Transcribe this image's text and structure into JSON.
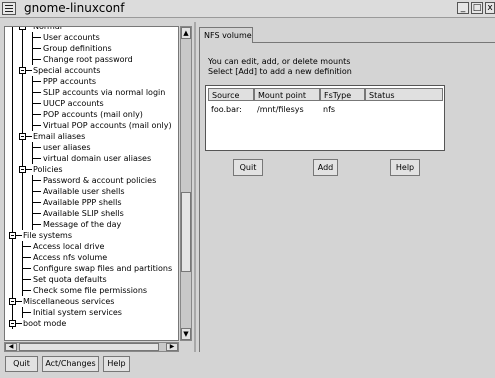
{
  "window": {
    "title": "gnome-linuxconf",
    "buttons": [
      "_",
      "□",
      "x"
    ]
  },
  "tree": {
    "items": [
      {
        "label": "Normal",
        "level": 1,
        "expanded": true
      },
      {
        "label": "User accounts",
        "level": 2
      },
      {
        "label": "Group definitions",
        "level": 2
      },
      {
        "label": "Change root password",
        "level": 2
      },
      {
        "label": "Special accounts",
        "level": 1,
        "expanded": true
      },
      {
        "label": "PPP accounts",
        "level": 2
      },
      {
        "label": "SLIP accounts via normal login",
        "level": 2
      },
      {
        "label": "UUCP accounts",
        "level": 2
      },
      {
        "label": "POP accounts (mail only)",
        "level": 2
      },
      {
        "label": "Virtual POP accounts (mail only)",
        "level": 2
      },
      {
        "label": "Email aliases",
        "level": 1,
        "expanded": true
      },
      {
        "label": "user aliases",
        "level": 2
      },
      {
        "label": "virtual domain user aliases",
        "level": 2
      },
      {
        "label": "Policies",
        "level": 1,
        "expanded": true
      },
      {
        "label": "Password & account policies",
        "level": 2
      },
      {
        "label": "Available user shells",
        "level": 2
      },
      {
        "label": "Available PPP shells",
        "level": 2
      },
      {
        "label": "Available SLIP shells",
        "level": 2
      },
      {
        "label": "Message of the day",
        "level": 2
      },
      {
        "label": "File systems",
        "level": 0,
        "expanded": true
      },
      {
        "label": "Access local drive",
        "level": 1
      },
      {
        "label": "Access nfs volume",
        "level": 1
      },
      {
        "label": "Configure swap files and partitions",
        "level": 1
      },
      {
        "label": "Set quota defaults",
        "level": 1
      },
      {
        "label": "Check some file permissions",
        "level": 1
      },
      {
        "label": "Miscellaneous services",
        "level": 0,
        "expanded": true
      },
      {
        "label": "Initial system services",
        "level": 1
      },
      {
        "label": "boot mode",
        "level": 0,
        "expanded": true
      }
    ]
  },
  "bottom_buttons": {
    "quit": "Quit",
    "act_changes": "Act/Changes",
    "help": "Help"
  },
  "tab": {
    "label": "NFS volume"
  },
  "main": {
    "help_line1": "You can edit, add, or delete mounts",
    "help_line2": "Select [Add] to add a new definition",
    "table": {
      "columns": [
        "Source",
        "Mount point",
        "FsType",
        "Status"
      ],
      "rows": [
        [
          "foo.bar:",
          "/mnt/filesys",
          "nfs",
          ""
        ]
      ]
    },
    "buttons": {
      "quit": "Quit",
      "add": "Add",
      "help": "Help"
    }
  }
}
